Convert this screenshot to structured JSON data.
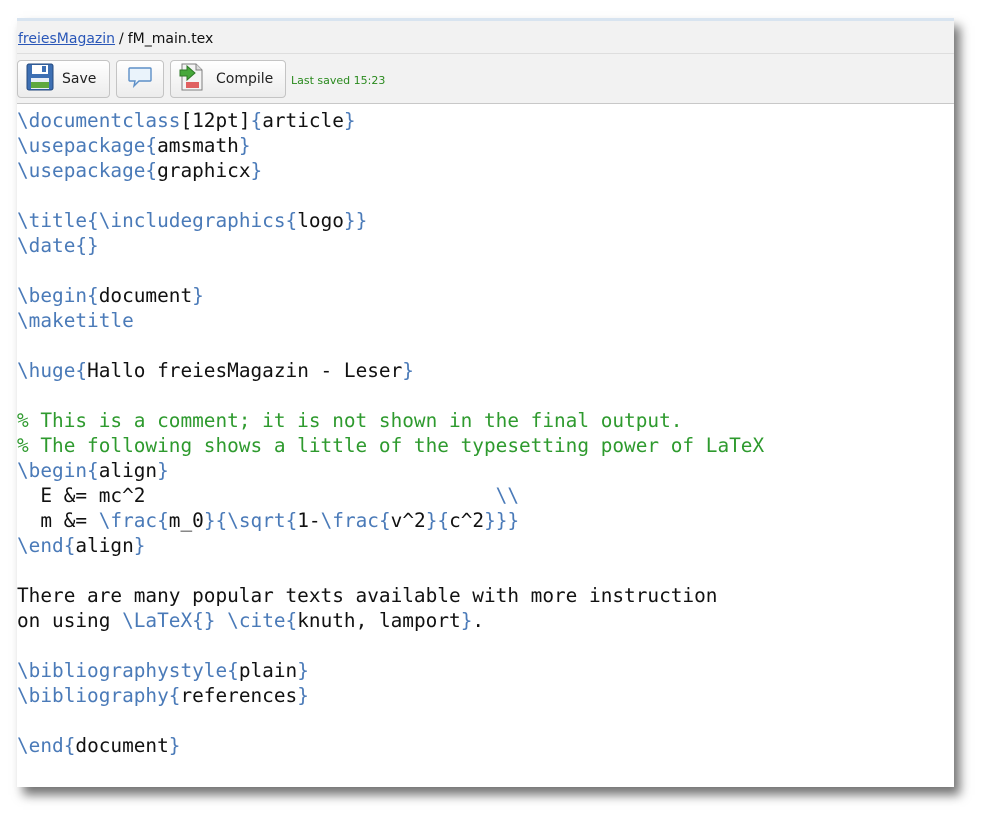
{
  "breadcrumb": {
    "project": "freiesMagazin",
    "separator": "/",
    "file": "fM_main.tex"
  },
  "toolbar": {
    "save_label": "Save",
    "compile_label": "Compile",
    "last_saved": "Last saved 15:23"
  },
  "icons": {
    "save": "floppy-disk-icon",
    "comment": "speech-bubble-icon",
    "compile": "document-arrow-icon"
  },
  "colors": {
    "command": "#4a7ab8",
    "comment": "#2e9a2e",
    "link": "#2a57b8",
    "status": "#2a8a1e"
  },
  "editor": {
    "lines": [
      [
        {
          "t": "\\documentclass",
          "c": "cmd"
        },
        {
          "t": "[12pt]",
          "c": "txt"
        },
        {
          "t": "{",
          "c": "brace"
        },
        {
          "t": "article",
          "c": "txt"
        },
        {
          "t": "}",
          "c": "brace"
        }
      ],
      [
        {
          "t": "\\usepackage",
          "c": "cmd"
        },
        {
          "t": "{",
          "c": "brace"
        },
        {
          "t": "amsmath",
          "c": "txt"
        },
        {
          "t": "}",
          "c": "brace"
        }
      ],
      [
        {
          "t": "\\usepackage",
          "c": "cmd"
        },
        {
          "t": "{",
          "c": "brace"
        },
        {
          "t": "graphicx",
          "c": "txt"
        },
        {
          "t": "}",
          "c": "brace"
        }
      ],
      [],
      [
        {
          "t": "\\title",
          "c": "cmd"
        },
        {
          "t": "{",
          "c": "brace"
        },
        {
          "t": "\\includegraphics",
          "c": "cmd"
        },
        {
          "t": "{",
          "c": "brace"
        },
        {
          "t": "logo",
          "c": "txt"
        },
        {
          "t": "}}",
          "c": "brace"
        }
      ],
      [
        {
          "t": "\\date",
          "c": "cmd"
        },
        {
          "t": "{}",
          "c": "brace"
        }
      ],
      [],
      [
        {
          "t": "\\begin",
          "c": "cmd"
        },
        {
          "t": "{",
          "c": "brace"
        },
        {
          "t": "document",
          "c": "txt"
        },
        {
          "t": "}",
          "c": "brace"
        }
      ],
      [
        {
          "t": "\\maketitle",
          "c": "cmd"
        }
      ],
      [],
      [
        {
          "t": "\\huge",
          "c": "cmd"
        },
        {
          "t": "{",
          "c": "brace"
        },
        {
          "t": "Hallo freiesMagazin - Leser",
          "c": "txt"
        },
        {
          "t": "}",
          "c": "brace"
        }
      ],
      [],
      [
        {
          "t": "% This is a comment; it is not shown in the final output.",
          "c": "comment"
        }
      ],
      [
        {
          "t": "% The following shows a little of the typesetting power of LaTeX",
          "c": "comment"
        }
      ],
      [
        {
          "t": "\\begin",
          "c": "cmd"
        },
        {
          "t": "{",
          "c": "brace"
        },
        {
          "t": "align",
          "c": "txt"
        },
        {
          "t": "}",
          "c": "brace"
        }
      ],
      [
        {
          "t": "  E &= mc^2                              ",
          "c": "txt"
        },
        {
          "t": "\\\\",
          "c": "cmd"
        }
      ],
      [
        {
          "t": "  m &= ",
          "c": "txt"
        },
        {
          "t": "\\frac",
          "c": "cmd"
        },
        {
          "t": "{",
          "c": "brace"
        },
        {
          "t": "m_0",
          "c": "txt"
        },
        {
          "t": "}{",
          "c": "brace"
        },
        {
          "t": "\\sqrt",
          "c": "cmd"
        },
        {
          "t": "{",
          "c": "brace"
        },
        {
          "t": "1-",
          "c": "txt"
        },
        {
          "t": "\\frac",
          "c": "cmd"
        },
        {
          "t": "{",
          "c": "brace"
        },
        {
          "t": "v^2",
          "c": "txt"
        },
        {
          "t": "}{",
          "c": "brace"
        },
        {
          "t": "c^2",
          "c": "txt"
        },
        {
          "t": "}}}",
          "c": "brace"
        }
      ],
      [
        {
          "t": "\\end",
          "c": "cmd"
        },
        {
          "t": "{",
          "c": "brace"
        },
        {
          "t": "align",
          "c": "txt"
        },
        {
          "t": "}",
          "c": "brace"
        }
      ],
      [],
      [
        {
          "t": "There are many popular texts available with more instruction",
          "c": "txt"
        }
      ],
      [
        {
          "t": "on using ",
          "c": "txt"
        },
        {
          "t": "\\LaTeX",
          "c": "cmd"
        },
        {
          "t": "{}",
          "c": "brace"
        },
        {
          "t": " ",
          "c": "txt"
        },
        {
          "t": "\\cite",
          "c": "cmd"
        },
        {
          "t": "{",
          "c": "brace"
        },
        {
          "t": "knuth, lamport",
          "c": "txt"
        },
        {
          "t": "}",
          "c": "brace"
        },
        {
          "t": ".",
          "c": "txt"
        }
      ],
      [],
      [
        {
          "t": "\\bibliographystyle",
          "c": "cmd"
        },
        {
          "t": "{",
          "c": "brace"
        },
        {
          "t": "plain",
          "c": "txt"
        },
        {
          "t": "}",
          "c": "brace"
        }
      ],
      [
        {
          "t": "\\bibliography",
          "c": "cmd"
        },
        {
          "t": "{",
          "c": "brace"
        },
        {
          "t": "references",
          "c": "txt"
        },
        {
          "t": "}",
          "c": "brace"
        }
      ],
      [],
      [
        {
          "t": "\\end",
          "c": "cmd"
        },
        {
          "t": "{",
          "c": "brace"
        },
        {
          "t": "document",
          "c": "txt"
        },
        {
          "t": "}",
          "c": "brace"
        }
      ]
    ]
  }
}
